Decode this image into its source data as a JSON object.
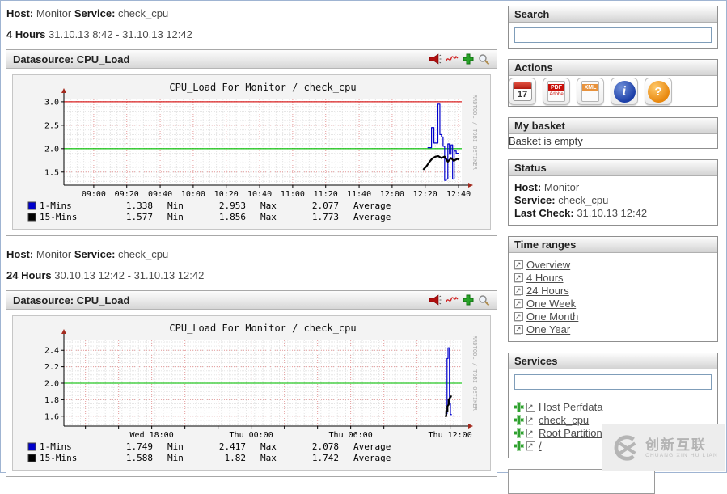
{
  "sections": [
    {
      "host_label": "Host:",
      "host": "Monitor",
      "service_label": "Service:",
      "service": "check_cpu",
      "period": "4 Hours",
      "date_range": "31.10.13 8:42 - 31.10.13 12:42",
      "datasource_label": "Datasource: CPU_Load"
    },
    {
      "host_label": "Host:",
      "host": "Monitor",
      "service_label": "Service:",
      "service": "check_cpu",
      "period": "24 Hours",
      "date_range": "30.10.13 12:42 - 31.10.13 12:42",
      "datasource_label": "Datasource: CPU_Load"
    }
  ],
  "chart_data": [
    {
      "type": "line",
      "title": "CPU_Load For Monitor / check_cpu",
      "watermark": "RRDTOOL / TOBI OETIKER",
      "ylim": [
        1.22,
        3.05
      ],
      "yticks": [
        1.5,
        2.0,
        2.5,
        3.0
      ],
      "yminor_step": 0.1,
      "xminor_count": 60,
      "xticks": [
        {
          "pos": 0.075,
          "label": "09:00"
        },
        {
          "pos": 0.158,
          "label": "09:20"
        },
        {
          "pos": 0.242,
          "label": "09:40"
        },
        {
          "pos": 0.325,
          "label": "10:00"
        },
        {
          "pos": 0.408,
          "label": "10:20"
        },
        {
          "pos": 0.492,
          "label": "10:40"
        },
        {
          "pos": 0.575,
          "label": "11:00"
        },
        {
          "pos": 0.658,
          "label": "11:20"
        },
        {
          "pos": 0.742,
          "label": "11:40"
        },
        {
          "pos": 0.825,
          "label": "12:00"
        },
        {
          "pos": 0.908,
          "label": "12:20"
        },
        {
          "pos": 0.992,
          "label": "12:40"
        }
      ],
      "xgrid_major": [
        0.075,
        0.158,
        0.242,
        0.325,
        0.408,
        0.492,
        0.575,
        0.658,
        0.742,
        0.825,
        0.908,
        0.992
      ],
      "hlines": [
        {
          "value": 3.0,
          "color": "#d40000"
        },
        {
          "value": 2.0,
          "color": "#00c000"
        }
      ],
      "series": [
        {
          "name": "1-Mins",
          "color": "#0000cc",
          "width": 1.2,
          "points": [
            [
              0.914,
              2.02
            ],
            [
              0.924,
              2.02
            ],
            [
              0.924,
              2.45
            ],
            [
              0.93,
              2.45
            ],
            [
              0.93,
              2.12
            ],
            [
              0.938,
              2.12
            ],
            [
              0.94,
              2.12
            ],
            [
              0.94,
              2.95
            ],
            [
              0.945,
              2.95
            ],
            [
              0.945,
              2.3
            ],
            [
              0.949,
              2.3
            ],
            [
              0.949,
              2.25
            ],
            [
              0.953,
              2.25
            ],
            [
              0.953,
              2.05
            ],
            [
              0.957,
              2.05
            ],
            [
              0.957,
              1.32
            ],
            [
              0.961,
              1.32
            ],
            [
              0.961,
              1.35
            ],
            [
              0.965,
              1.35
            ],
            [
              0.965,
              2.1
            ],
            [
              0.969,
              2.1
            ],
            [
              0.969,
              1.88
            ],
            [
              0.973,
              1.88
            ],
            [
              0.973,
              2.08
            ],
            [
              0.977,
              2.08
            ],
            [
              0.977,
              1.35
            ],
            [
              0.981,
              1.35
            ],
            [
              0.981,
              1.95
            ],
            [
              0.986,
              1.95
            ],
            [
              0.986,
              1.9
            ],
            [
              0.992,
              1.9
            ]
          ]
        },
        {
          "name": "15-Mins",
          "color": "#000000",
          "width": 2.2,
          "points": [
            [
              0.903,
              1.55
            ],
            [
              0.911,
              1.62
            ],
            [
              0.919,
              1.72
            ],
            [
              0.926,
              1.79
            ],
            [
              0.934,
              1.83
            ],
            [
              0.941,
              1.84
            ],
            [
              0.949,
              1.8
            ],
            [
              0.957,
              1.83
            ],
            [
              0.965,
              1.72
            ],
            [
              0.973,
              1.8
            ],
            [
              0.98,
              1.74
            ],
            [
              0.988,
              1.78
            ],
            [
              0.994,
              1.77
            ]
          ]
        }
      ],
      "legend": [
        {
          "name": "1-Mins",
          "color": "#0000cc",
          "min": "1.338",
          "min_label": "Min",
          "max": "2.953",
          "max_label": "Max",
          "avg": "2.077",
          "avg_label": "Average"
        },
        {
          "name": "15-Mins",
          "color": "#000000",
          "min": "1.577",
          "min_label": "Min",
          "max": "1.856",
          "max_label": "Max",
          "avg": "1.773",
          "avg_label": "Average"
        }
      ]
    },
    {
      "type": "line",
      "title": "CPU_Load For Monitor / check_cpu",
      "watermark": "RRDTOOL / TOBI OETIKER",
      "ylim": [
        1.48,
        2.52
      ],
      "yticks": [
        1.6,
        1.8,
        2.0,
        2.2,
        2.4
      ],
      "yminor_step": 0.05,
      "xminor_count": 48,
      "xticks": [
        {
          "pos": 0.2208,
          "label": "Wed 18:00"
        },
        {
          "pos": 0.4708,
          "label": "Thu 00:00"
        },
        {
          "pos": 0.7208,
          "label": "Thu 06:00"
        },
        {
          "pos": 0.9708,
          "label": "Thu 12:00"
        }
      ],
      "xgrid_major": [
        0.0542,
        0.1375,
        0.2208,
        0.3042,
        0.3875,
        0.4708,
        0.5542,
        0.6375,
        0.7208,
        0.8042,
        0.8875,
        0.9708
      ],
      "hlines": [
        {
          "value": 2.0,
          "color": "#00c000"
        }
      ],
      "series": [
        {
          "name": "1-Mins",
          "color": "#0000cc",
          "width": 1.2,
          "points": [
            [
              0.96,
              1.63
            ],
            [
              0.963,
              1.63
            ],
            [
              0.963,
              2.3
            ],
            [
              0.9655,
              2.3
            ],
            [
              0.9655,
              2.43
            ],
            [
              0.969,
              2.43
            ],
            [
              0.969,
              1.75
            ],
            [
              0.9715,
              1.75
            ],
            [
              0.9715,
              1.62
            ],
            [
              0.975,
              1.62
            ]
          ]
        },
        {
          "name": "15-Mins",
          "color": "#000000",
          "width": 2.2,
          "points": [
            [
              0.958,
              1.6
            ],
            [
              0.961,
              1.6
            ],
            [
              0.961,
              1.66
            ],
            [
              0.964,
              1.66
            ],
            [
              0.964,
              1.72
            ],
            [
              0.967,
              1.74
            ],
            [
              0.967,
              1.8
            ],
            [
              0.97,
              1.82
            ],
            [
              0.9725,
              1.84
            ],
            [
              0.975,
              1.84
            ]
          ]
        }
      ],
      "legend": [
        {
          "name": "1-Mins",
          "color": "#0000cc",
          "min": "1.749",
          "min_label": "Min",
          "max": "2.417",
          "max_label": "Max",
          "avg": "2.078",
          "avg_label": "Average"
        },
        {
          "name": "15-Mins",
          "color": "#000000",
          "min": "1.588",
          "min_label": "Min",
          "max": "1.82",
          "max_label": "Max",
          "avg": "1.742",
          "avg_label": "Average"
        }
      ]
    }
  ],
  "sidebar": {
    "search": {
      "title": "Search",
      "value": ""
    },
    "actions": {
      "title": "Actions",
      "calendar_glyph": "17",
      "pdf_glyph": "PDF",
      "pdf_sub": "Adobe",
      "xml_glyph": "XML",
      "info_glyph": "i",
      "help_glyph": "?"
    },
    "basket": {
      "title": "My basket",
      "empty_text": "Basket is empty"
    },
    "status": {
      "title": "Status",
      "host_label": "Host:",
      "host": "Monitor",
      "service_label": "Service:",
      "service": "check_cpu",
      "last_check_label": "Last Check:",
      "last_check": "31.10.13 12:42"
    },
    "time_ranges": {
      "title": "Time ranges",
      "items": [
        {
          "label": "Overview"
        },
        {
          "label": "4 Hours"
        },
        {
          "label": "24 Hours"
        },
        {
          "label": "One Week"
        },
        {
          "label": "One Month"
        },
        {
          "label": "One Year"
        }
      ]
    },
    "services": {
      "title": "Services",
      "filter_value": "",
      "items": [
        {
          "label": "Host Perfdata"
        },
        {
          "label": "check_cpu"
        },
        {
          "label": "Root Partition"
        },
        {
          "label": "/"
        }
      ]
    }
  },
  "watermark": {
    "line1": "创新互联",
    "line2": "CHUANG XIN HU LIAN"
  }
}
